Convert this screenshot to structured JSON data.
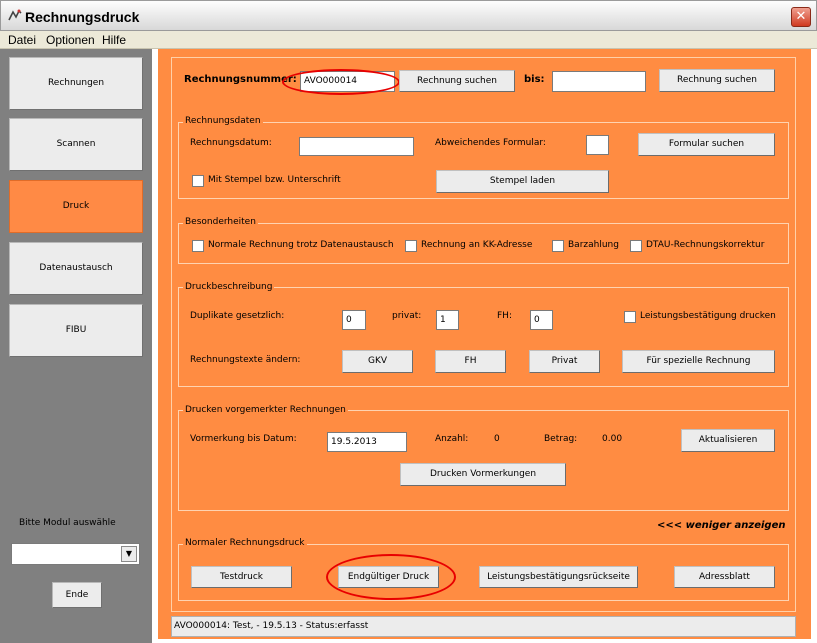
{
  "window": {
    "title": "Rechnungsdruck",
    "close_icon": "close-icon"
  },
  "menu": {
    "items": [
      "Datei",
      "Optionen",
      "Hilfe"
    ]
  },
  "sidebar": {
    "modules": [
      "Rechnungen",
      "Scannen",
      "Druck",
      "Datenaustausch",
      "FIBU"
    ],
    "active_module": "Druck",
    "module_label": "Bitte Modul auswähle",
    "module_select_value": "",
    "end_button": "Ende"
  },
  "search": {
    "label": "Rechnungsnummer:",
    "from_value": "AVO000014",
    "search_button": "Rechnung suchen",
    "to_label": "bis:",
    "to_value": "",
    "search_button_2": "Rechnung suchen"
  },
  "rechnungsdaten": {
    "legend": "Rechnungsdaten",
    "date_label": "Rechnungsdatum:",
    "date_value": "",
    "form_label": "Abweichendes Formular:",
    "form_value": "",
    "form_button": "Formular suchen",
    "stamp_checkbox": "Mit Stempel bzw. Unterschrift",
    "stamp_button": "Stempel laden"
  },
  "besonderheiten": {
    "legend": "Besonderheiten",
    "options": [
      "Normale Rechnung trotz Datenaustausch",
      "Rechnung an KK-Adresse",
      "Barzahlung",
      "DTAU-Rechnungskorrektur"
    ]
  },
  "druckbeschreibung": {
    "legend": "Druckbeschreibung",
    "duplicates_label": "Duplikate gesetzlich:",
    "duplicates_value": "0",
    "private_label": "privat:",
    "private_value": "1",
    "fh_label": "FH:",
    "fh_value": "0",
    "service_checkbox": "Leistungsbestätigung drucken",
    "texts_label": "Rechnungstexte ändern:",
    "text_buttons": [
      "GKV",
      "FH",
      "Privat",
      "Für spezielle Rechnung"
    ]
  },
  "vorgemerkt": {
    "legend": "Drucken vorgemerkter Rechnungen",
    "until_label": "Vormerkung bis Datum:",
    "until_value": "19.5.2013",
    "count_label": "Anzahl:",
    "count_value": "0",
    "amount_label": "Betrag:",
    "amount_value": "0.00",
    "refresh_button": "Aktualisieren",
    "print_button": "Drucken Vormerkungen"
  },
  "less_link": "<<< weniger anzeigen",
  "normal_print": {
    "legend": "Normaler Rechnungsdruck",
    "buttons": [
      "Testdruck",
      "Endgültiger Druck",
      "Leistungsbestätigungsrückseite",
      "Adressblatt"
    ]
  },
  "status": {
    "text": "AVO000014: Test,  - 19.5.13 - Status:erfasst"
  },
  "colors": {
    "accent": "#ff8c42",
    "highlight": "#e80000",
    "sidebar": "#808080"
  }
}
